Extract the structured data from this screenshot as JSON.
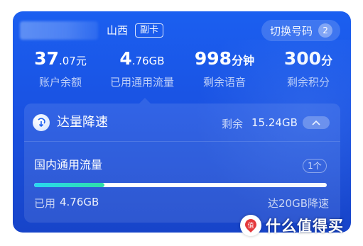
{
  "header": {
    "province": "山西",
    "sub_badge": "副卡",
    "switch_label": "切换号码",
    "switch_count": "2"
  },
  "stats": {
    "balance": {
      "int": "37",
      "dec": ".07",
      "unit": "元",
      "label": "账户余额"
    },
    "traffic": {
      "int": "4",
      "dec": ".76",
      "unit": "GB",
      "label": "已用通用流量"
    },
    "voice": {
      "value": "998",
      "unit": "分钟",
      "label": "剩余语音"
    },
    "points": {
      "value": "300",
      "unit": "分",
      "label": "剩余积分"
    }
  },
  "package": {
    "title": "达量降速",
    "remain_label": "剩余",
    "remain_value": "15.24GB",
    "icon": "download-arrow-icon",
    "collapse_icon": "chevron-up-icon"
  },
  "flow": {
    "title": "国内通用流量",
    "count": "1个",
    "used_label": "已用",
    "used_value": "4.76GB",
    "limit_text": "达20GB降速",
    "progress_fraction": 0.24
  },
  "watermark": {
    "logo_glyph": "值",
    "text": "什么值得买"
  },
  "colors": {
    "card_top": "#1b5ff0",
    "card_bottom": "#1744c9",
    "progress_start": "#2ad7f2",
    "progress_end": "#2ee0a8",
    "watermark_logo": "#e4393c"
  }
}
